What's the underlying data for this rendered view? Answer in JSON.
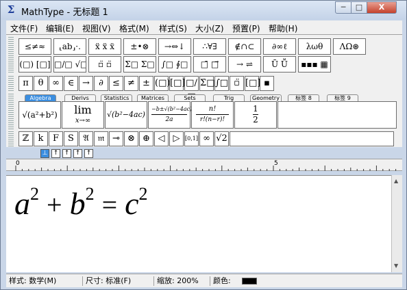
{
  "window": {
    "title": "MathType - 无标题 1",
    "min": "─",
    "max": "□",
    "close": "X"
  },
  "menu": [
    "文件(F)",
    "编辑(E)",
    "视图(V)",
    "格式(M)",
    "样式(S)",
    "大小(Z)",
    "预置(P)",
    "帮助(H)"
  ],
  "palette_row1": [
    "≤≠≈",
    "⸤ab⸥·.",
    "ẍ ẍ ẍ",
    "±•⊗",
    "→⇔↓",
    "∴∀∃",
    "∉∩⊂",
    "∂∞ℓ",
    "λωθ",
    "ΛΩ⊛"
  ],
  "palette_row2": [
    "(□) [□]",
    "□/□ √□",
    "▫̈ ▫̈",
    "Σ□ Σ□",
    "∫□ ∮□",
    "□̄ □⃗",
    "→ ⇌",
    "Ū Ṻ",
    "▪▪▪ ▦"
  ],
  "symbols_row": [
    "π",
    "θ",
    "∞",
    "∈",
    "→",
    "∂",
    "≤",
    "≠",
    "±",
    "(□)",
    "[□]",
    "□/□",
    "Σ̇□",
    "∫□",
    "▫̈",
    "[□]",
    "▪"
  ],
  "tabs": [
    "Algebra",
    "Derivs",
    "Statistics",
    "Matrices",
    "Sets",
    "Trig",
    "Geometry",
    "标签 8",
    "标签 9"
  ],
  "templates": {
    "t1": "√(a²+b²)",
    "t2_top": "lim",
    "t2_bottom": "x→∞",
    "t3": "√(b²−4ac)",
    "t4_top": "−b±√(b²−4ac)",
    "t4_bottom": "2a",
    "t5_top": "n!",
    "t5_bottom": "r!(n−r)!",
    "t6_top": "1",
    "t6_bottom": "2"
  },
  "small_row": [
    "ℤ",
    "k",
    "F",
    "S",
    "𝔄",
    "𝔪",
    "⊸",
    "⊗",
    "⊕",
    "◁",
    "▷",
    "[0,1]",
    "∞",
    "√2"
  ],
  "ruler": {
    "mark0": "0",
    "mark5": "5"
  },
  "equation": {
    "a": "a",
    "exp": "2",
    "plus": "+",
    "b": "b",
    "eq": "=",
    "c": "c"
  },
  "status": {
    "style": "样式: 数学(M)",
    "size": "尺寸: 标准(F)",
    "zoom": "缩放: 200%",
    "color_label": "颜色:"
  },
  "colors": {
    "accent": "#3b8ee0",
    "swatch": "#000000"
  }
}
